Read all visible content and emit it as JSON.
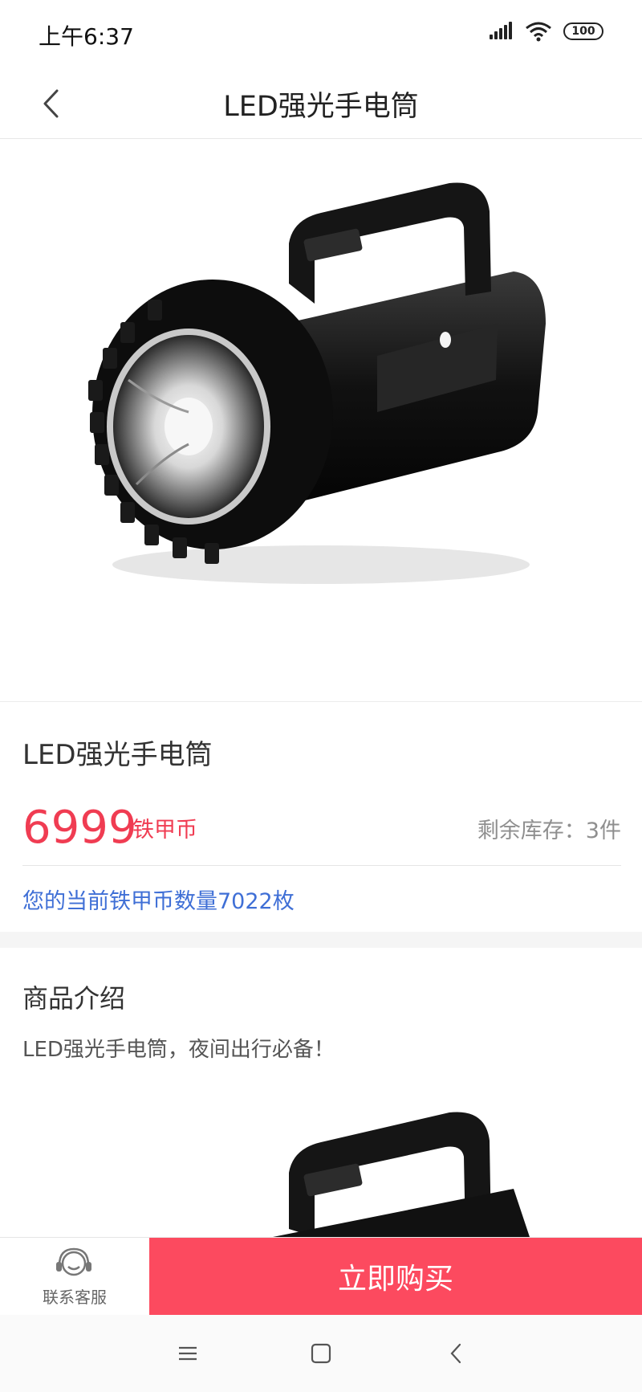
{
  "status_bar": {
    "time": "上午6:37",
    "battery": "100"
  },
  "nav": {
    "title": "LED强光手电筒"
  },
  "product": {
    "name": "LED强光手电筒",
    "price": "6999",
    "price_unit": "铁甲币",
    "stock": "剩余库存：3件",
    "balance": "您的当前铁甲币数量7022枚"
  },
  "intro": {
    "title": "商品介绍",
    "text": "LED强光手电筒，夜间出行必备！"
  },
  "bottom": {
    "contact_label": "联系客服",
    "buy_label": "立即购买"
  },
  "colors": {
    "accent": "#fc4a5f",
    "price": "#f03c52",
    "link": "#3f6fd6"
  },
  "icons": [
    "back-icon",
    "signal-icon",
    "wifi-icon",
    "battery-icon",
    "headset-icon",
    "menu-icon",
    "home-icon",
    "back-nav-icon"
  ]
}
